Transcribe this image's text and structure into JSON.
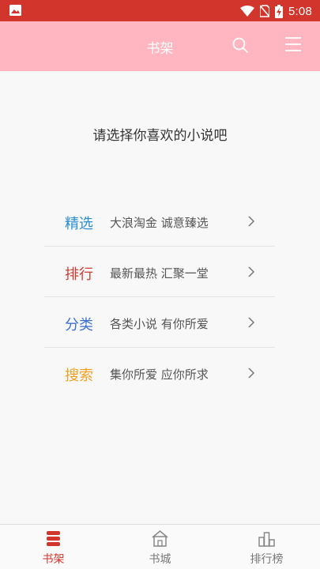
{
  "status_bar": {
    "time": "5:08",
    "icons": [
      "image-icon",
      "wifi-icon",
      "no-sim-icon",
      "battery-charging-icon"
    ]
  },
  "header": {
    "title": "书架",
    "icons": [
      "search-icon",
      "menu-icon"
    ]
  },
  "prompt": "请选择你喜欢的小说吧",
  "menu": [
    {
      "title": "精选",
      "desc": "大浪淘金  诚意臻选",
      "color": "#2a8fd4"
    },
    {
      "title": "排行",
      "desc": "最新最热  汇聚一堂",
      "color": "#d43a30"
    },
    {
      "title": "分类",
      "desc": "各类小说  有你所爱",
      "color": "#3d6fd0"
    },
    {
      "title": "搜索",
      "desc": "集你所爱  应你所求",
      "color": "#f0a020"
    }
  ],
  "bottom_nav": [
    {
      "label": "书架",
      "icon": "bookshelf-icon",
      "active": true
    },
    {
      "label": "书城",
      "icon": "store-icon",
      "active": false
    },
    {
      "label": "排行榜",
      "icon": "ranking-icon",
      "active": false
    }
  ],
  "colors": {
    "status_bar": "#d2352b",
    "app_bar": "#ffb6c1",
    "active_tab": "#d2352b"
  }
}
